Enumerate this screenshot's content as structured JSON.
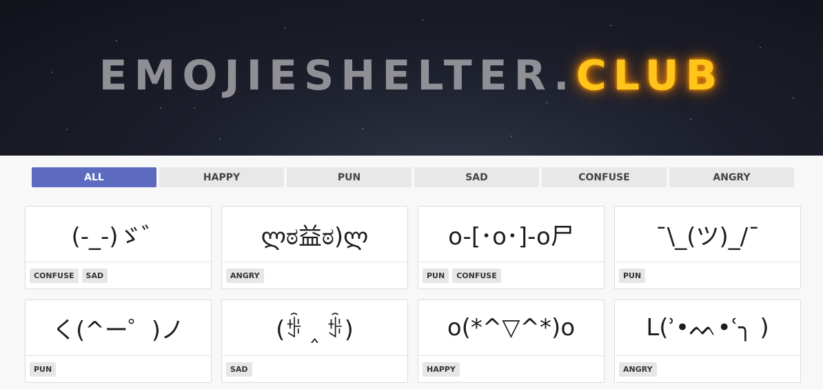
{
  "header": {
    "logo_name": "EMOJIESHELTER.",
    "logo_tld": "CLUB"
  },
  "filters": [
    "ALL",
    "HAPPY",
    "PUN",
    "SAD",
    "CONFUSE",
    "ANGRY"
  ],
  "active_filter": "ALL",
  "cards": [
    {
      "emoticon": "(-_-)ゞ゛",
      "tags": [
        "CONFUSE",
        "SAD"
      ]
    },
    {
      "emoticon": "ლಠ益ಠ)ლ",
      "tags": [
        "ANGRY"
      ]
    },
    {
      "emoticon": "o-[･o･]-o尸",
      "tags": [
        "PUN",
        "CONFUSE"
      ]
    },
    {
      "emoticon": "¯\\_(ツ)_/¯",
      "tags": [
        "PUN"
      ]
    },
    {
      "emoticon": "く(^ー゜)ノ",
      "tags": [
        "PUN"
      ]
    },
    {
      "emoticon": "(ꌢ ‸ ꌢ)",
      "tags": [
        "SAD"
      ]
    },
    {
      "emoticon": "o(*^▽^*)o",
      "tags": [
        "HAPPY"
      ]
    },
    {
      "emoticon": "ᒪ(ʾ•ᨓ•ʿ╮ )",
      "tags": [
        "ANGRY"
      ]
    }
  ]
}
